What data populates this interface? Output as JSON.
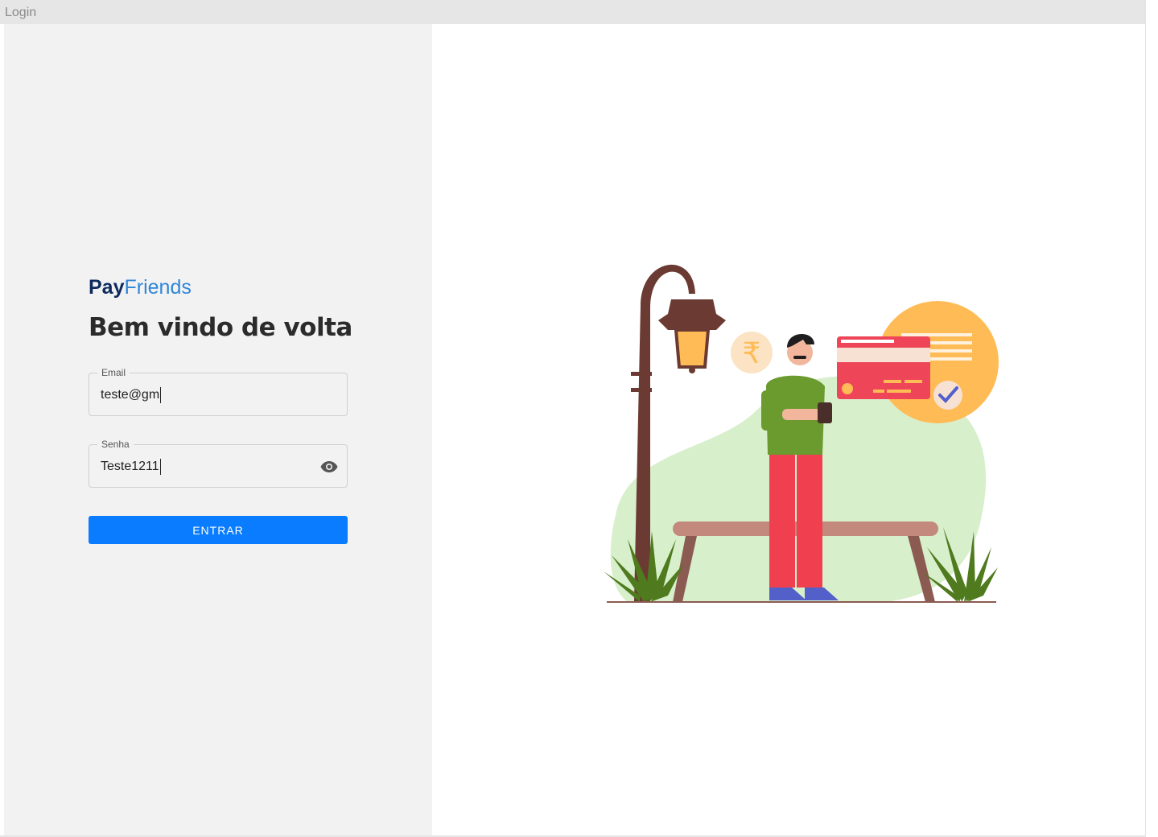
{
  "window": {
    "title": "Login"
  },
  "brand": {
    "part1": "Pay",
    "part2": "Friends"
  },
  "heading": "Bem vindo de volta",
  "form": {
    "email": {
      "label": "Email",
      "value": "teste@gm"
    },
    "password": {
      "label": "Senha",
      "value": "Teste1211",
      "toggle_icon": "eye-icon"
    },
    "submit_label": "ENTRAR"
  },
  "illustration": {
    "currency_symbol": "₹",
    "colors": {
      "accent": "#0a7cff",
      "brand_dark": "#0d2b5e",
      "brand_light": "#2f86d8"
    }
  }
}
